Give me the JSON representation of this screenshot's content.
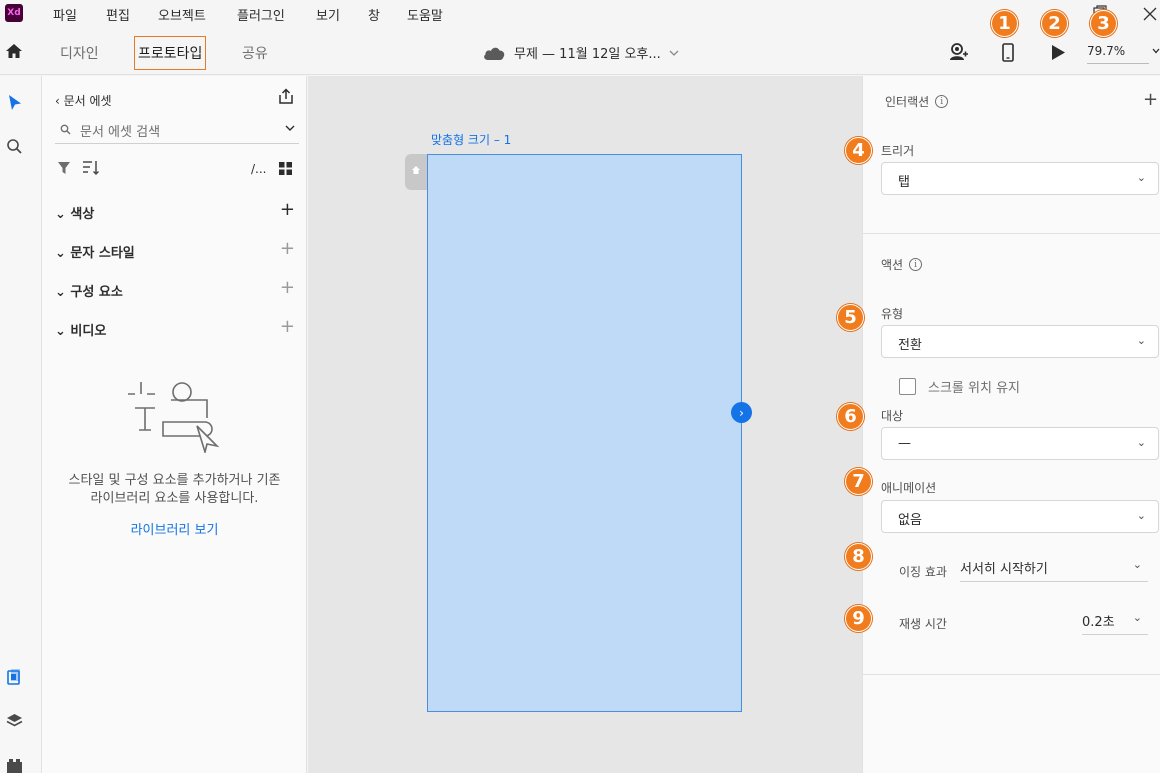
{
  "menu": {
    "logo": "Xd",
    "items": [
      "파일",
      "편집",
      "오브젝트",
      "플러그인",
      "보기",
      "창",
      "도움말"
    ]
  },
  "toolbar": {
    "tabs": [
      "디자인",
      "프로토타입",
      "공유"
    ],
    "active_tab": "프로토타입",
    "doc_title": "무제 — 11월 12일 오후...",
    "zoom": "79.7%"
  },
  "badges": [
    "1",
    "2",
    "3",
    "4",
    "5",
    "6",
    "7",
    "8",
    "9"
  ],
  "assets": {
    "title": "문서 에셋",
    "search_placeholder": "문서 에셋 검색",
    "sort_label": "/...",
    "sections": [
      "색상",
      "문자 스타일",
      "구성 요소",
      "비디오"
    ],
    "empty_text_1": "스타일 및 구성 요소를 추가하거나 기존",
    "empty_text_2": "라이브러리 요소를 사용합니다.",
    "library_link": "라이브러리 보기"
  },
  "canvas": {
    "artboard_label": "맞춤형 크기 – 1"
  },
  "props": {
    "interaction_header": "인터랙션",
    "trigger_label": "트리거",
    "trigger_value": "탭",
    "action_header": "액션",
    "type_label": "유형",
    "type_value": "전환",
    "keep_scroll_label": "스크롤 위치 유지",
    "target_label": "대상",
    "target_value": "—",
    "animation_label": "애니메이션",
    "animation_value": "없음",
    "easing_label": "이징 효과",
    "easing_value": "서서히 시작하기",
    "duration_label": "재생 시간",
    "duration_value": "0.2초"
  },
  "colors": {
    "badge": "#f07c1e",
    "accent": "#1473e6",
    "artboard_fill": "#bedaf7"
  }
}
